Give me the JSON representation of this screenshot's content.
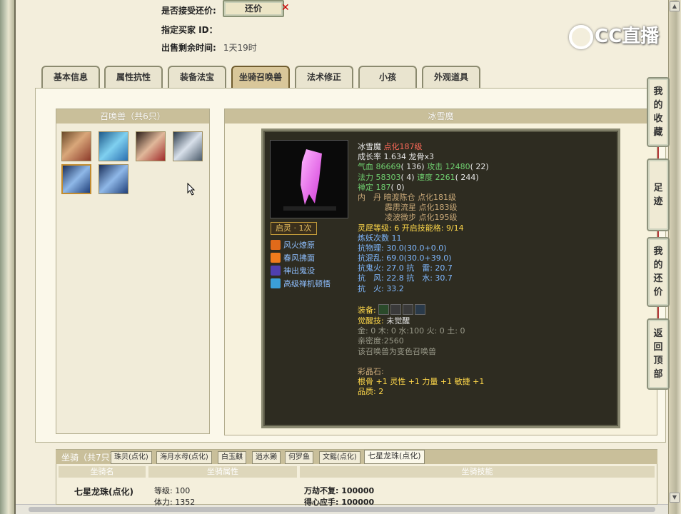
{
  "top_info": {
    "accept_counter_label": "是否接受还价:",
    "counter_button": "还价",
    "buyer_id_label": "指定买家 ID：",
    "time_left_label": "出售剩余时间:",
    "time_left_value": "1天19时"
  },
  "logo": {
    "text": "CC直播"
  },
  "tabs": [
    {
      "label": "基本信息"
    },
    {
      "label": "属性抗性"
    },
    {
      "label": "装备法宝"
    },
    {
      "label": "坐骑召唤兽"
    },
    {
      "label": "法术修正"
    },
    {
      "label": "小孩"
    },
    {
      "label": "外观道具"
    }
  ],
  "summon_panel": {
    "title": "召唤兽（共6只）"
  },
  "detail": {
    "title": "冰雪魔",
    "qiling": "启灵 · 1次",
    "skills": [
      {
        "name": "风火燎原",
        "icon": "fire-icon",
        "color": "#e06a1a"
      },
      {
        "name": "春风拂面",
        "icon": "flame-icon",
        "color": "#ef7b1c"
      },
      {
        "name": "神出鬼没",
        "icon": "ghost-icon",
        "color": "#4f3fb0"
      },
      {
        "name": "高级禅机顿悟",
        "icon": "zen-icon",
        "color": "#3b9fd8"
      }
    ],
    "name": "冰雪魔",
    "level": "点化187级",
    "growth": "成长率 1.634 龙骨x3",
    "hp_label": "气血",
    "hp": "86669",
    "hp_extra": "( 136)",
    "atk_label": "攻击",
    "atk": "12480",
    "atk_extra": "( 22)",
    "mp_label": "法力",
    "mp": "58303",
    "mp_extra": "( 4)",
    "speed_label": "速度",
    "speed": "2261",
    "speed_extra": "( 244)",
    "calm_label": "禅定",
    "calm": "187",
    "calm_extra": "( 0)",
    "neidan_label": "内　丹",
    "neidan": [
      "暗渡陈仓 点化181级",
      "霹雳流星 点化183级",
      "凌波微步 点化195级"
    ],
    "lingxi_label": "灵犀等级:",
    "lingxi_value": "6",
    "skill_grid_label": "开启技能格:",
    "skill_grid_value": "9/14",
    "lianyao": "炼妖次数 11",
    "resist": [
      "抗物理: 30.0(30.0+0.0)",
      "抗混乱: 69.0(30.0+39.0)"
    ],
    "resist_ghost": "抗鬼火: 27.0 抗　雷: 20.7",
    "resist_wind": "抗　风: 22.8 抗　水: 30.7",
    "resist_fire": "抗　火: 33.2",
    "equip_label": "装备:",
    "awaken_label": "觉醒技:",
    "awaken_value": "未觉醒",
    "elements": "金: 0 木: 0 水:100 火: 0 土: 0",
    "intimacy": "亲密度:2560",
    "transform": "该召唤兽为变色召唤兽",
    "gem_label": "彩晶石:",
    "gem_value": "根骨 +1 灵性 +1 力量 +1 敏捷 +1",
    "quality": "品质: 2"
  },
  "mount": {
    "title": "坐骑（共7只）",
    "tabs": [
      "珠贝(点化)",
      "海月水母(点化)",
      "白玉麒",
      "逍水獭",
      "何罗鱼",
      "文鳐(点化)",
      "七星龙珠(点化)"
    ],
    "col_name": "坐骑名",
    "col_attr": "坐骑属性",
    "col_skill": "坐骑技能",
    "name": "七星龙珠(点化)",
    "level": "等级: 100",
    "stamina": "体力: 1352",
    "skill1": "万劫不复: 100000",
    "skill2": "得心应手: 100000"
  },
  "side_buttons": [
    {
      "label": [
        "我",
        "的",
        "收",
        "藏"
      ]
    },
    {
      "label": [
        "足",
        "迹"
      ]
    },
    {
      "label": [
        "我",
        "的",
        "还",
        "价"
      ]
    },
    {
      "label": [
        "返",
        "回",
        "顶",
        "部"
      ]
    }
  ]
}
